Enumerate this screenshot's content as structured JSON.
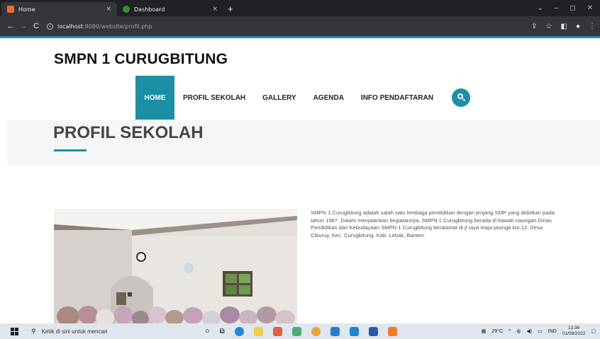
{
  "browser": {
    "tabs": [
      {
        "label": "Home",
        "active": true,
        "favicon_color": "#e8702a"
      },
      {
        "label": "Dashboard",
        "active": false,
        "favicon_color": "#3c8d3c"
      }
    ],
    "tab_close": "×",
    "new_tab": "+",
    "url_host": "localhost",
    "url_path": ":8080/website/profil.php",
    "window_controls": [
      "⌄",
      "–",
      "◻",
      "✕"
    ]
  },
  "site": {
    "title": "SMPN 1 CURUGBITUNG",
    "accent_color": "#1b8fa6",
    "menu": [
      "HOME",
      "PROFIL SEKOLAH",
      "GALLERY",
      "AGENDA",
      "INFO PENDAFTARAN"
    ],
    "active_menu": "HOME",
    "page_heading": "PROFIL SEKOLAH",
    "about_text": "SMPN 1 Curugbitung adalah salah satu lembaga pendidikan dengan jenjang SMP yang didirikan pada tahun 1987. Dalam menjalankan kegiatannya, SMPN 1 Curugbitung berada di bawah naungan Dinas Pendidikan dan Kebudayaan SMPN 1 Curugbitung beralamat di jl raya maja-jasinga km.12, Desa Ciburuy, Kec. Curugbitung, Kab. Lebak, Banten."
  },
  "taskbar": {
    "search_placeholder": "Ketik di sini untuk mencari",
    "temperature": "29°C",
    "language": "IND",
    "time": "13.36",
    "date": "01/08/2022"
  }
}
